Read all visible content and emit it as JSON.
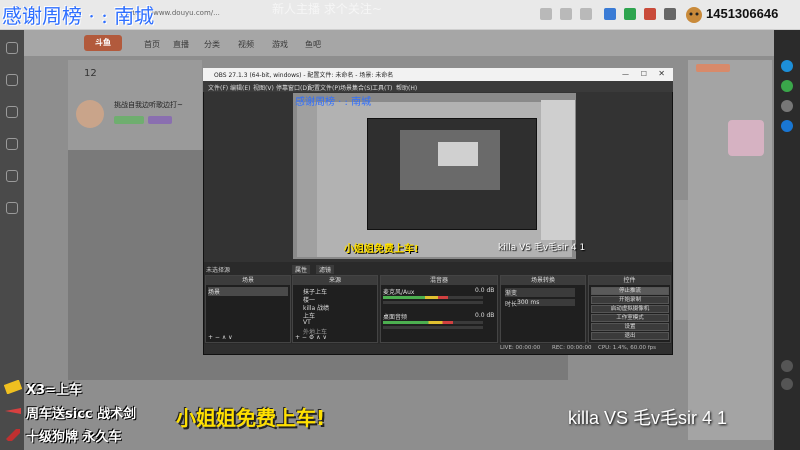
{
  "browser": {
    "url": "https://www.douyu.com/..."
  },
  "site": {
    "logo": "斗鱼",
    "nav": [
      "首页",
      "直播",
      "分类",
      "视频",
      "游戏",
      "鱼吧"
    ],
    "room_title": "挑战自我边听歌边打~",
    "follower_count": "12"
  },
  "obs": {
    "title": "OBS 27.1.3 (64-bit, windows) - 配置文件: 未命名 - 场景: 未命名",
    "menu": [
      "文件(F)",
      "编辑(E)",
      "视图(V)",
      "停靠窗口(D)",
      "配置文件(P)",
      "场景集合(S)",
      "工具(T)",
      "帮助(H)"
    ],
    "scene_tabs": [
      "未选择源",
      "属性",
      "滤镜"
    ],
    "docks": {
      "scenes": {
        "title": "场景",
        "items": [
          "场景"
        ]
      },
      "sources": {
        "title": "来源",
        "items": [
          "抹子上车",
          "楼一",
          "killa 战绩",
          "上车",
          "VT",
          "外地上车"
        ]
      },
      "mixer": {
        "title": "混音器",
        "tracks": [
          {
            "name": "麦克风/Aux",
            "db": "0.0 dB",
            "level": 0.65
          },
          {
            "name": "桌面音频",
            "db": "0.0 dB",
            "level": 0.7
          }
        ]
      },
      "transitions": {
        "title": "场景转换",
        "mode": "渐变",
        "duration_label": "时长",
        "duration": "300 ms"
      },
      "controls": {
        "title": "控件",
        "buttons": [
          "停止推流",
          "开始录制",
          "启动虚拟摄像机",
          "工作室模式",
          "设置",
          "退出"
        ]
      }
    },
    "status": [
      "LIVE: 00:00:00",
      "REC: 00:00:00",
      "CPU: 1.4%, 60.00 fps"
    ]
  },
  "overlays": {
    "thanks": "感谢周榜 · : 南城",
    "hint": "新人主播  求个关注~",
    "counter": "1451306646",
    "free_ride": "小姐姐免费上车!",
    "versus": "killa VS 毛v毛sir 4 1",
    "perks": [
      {
        "icon": "ticket-icon",
        "text": "X3=上车"
      },
      {
        "icon": "plane-icon",
        "text": "周车送sicc 战术剑"
      },
      {
        "icon": "rocket-icon",
        "text": "十级狗牌 永久车"
      }
    ]
  },
  "colors": {
    "thanks_blue": "#2f6fff",
    "free_ride_yellow": "#ffe000",
    "obs_dark": "#2b2b2b"
  }
}
